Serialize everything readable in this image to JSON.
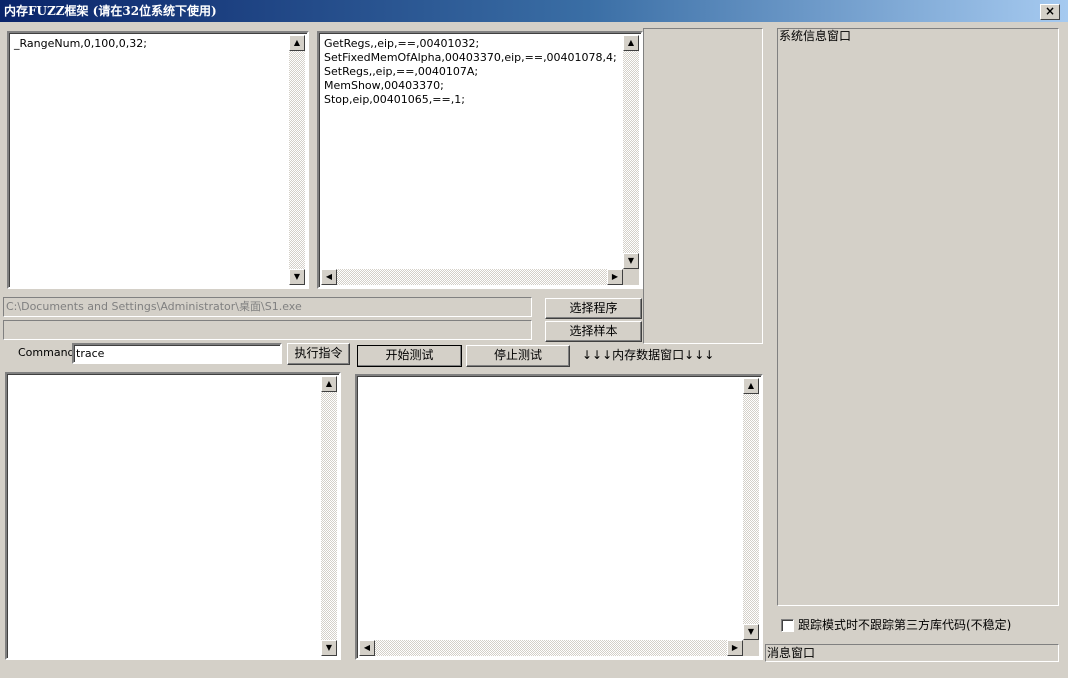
{
  "window": {
    "title": "内存FUZZ框架 (请在32位系统下使用)",
    "close_label": "×"
  },
  "config_text": "_RangeNum,0,100,0,32;",
  "script_text": "GetRegs,,eip,==,00401032;\nSetFixedMemOfAlpha,00403370,eip,==,00401078,4;\nSetRegs,,eip,==,0040107A;\nMemShow,00403370;\nStop,eip,00401065,==,1;",
  "program_path": "C:\\Documents and Settings\\Administrator\\桌面\\S1.exe",
  "sample_path": "",
  "buttons": {
    "select_program": "选择程序",
    "select_sample": "选择样本",
    "exec_command": "执行指令",
    "start_test": "开始测试",
    "stop_test": "停止测试"
  },
  "command": {
    "label": "Command",
    "value": "trace"
  },
  "memory_window_label": "↓↓↓内存数据窗口↓↓↓",
  "sysinfo_label": "系统信息窗口",
  "checkbox_label": "跟踪模式时不跟踪第三方库代码(不稳定)",
  "message_label": "消息窗口",
  "icons": {
    "up": "▲",
    "down": "▼",
    "left": "◀",
    "right": "▶"
  }
}
